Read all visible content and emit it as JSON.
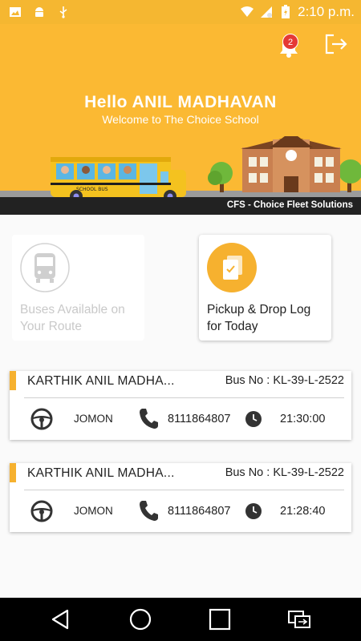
{
  "status_bar": {
    "time": "2:10 p.m."
  },
  "header": {
    "notification_count": "2",
    "greeting": "Hello ANIL MADHAVAN",
    "subtitle": "Welcome to The Choice School",
    "bus_sign": "SCHOOL BUS",
    "brand": "CFS - Choice Fleet Solutions"
  },
  "tiles": [
    {
      "label": "Buses Available on Your Route",
      "icon": "bus-icon",
      "enabled": false
    },
    {
      "label": "Pickup & Drop Log for Today",
      "icon": "log-icon",
      "enabled": true
    }
  ],
  "trips": [
    {
      "student": "KARTHIK ANIL MADHA...",
      "bus_no": "Bus No : KL-39-L-2522",
      "driver": "JOMON",
      "phone": "8111864807",
      "time": "21:30:00"
    },
    {
      "student": "KARTHIK ANIL MADHA...",
      "bus_no": "Bus No : KL-39-L-2522",
      "driver": "JOMON",
      "phone": "8111864807",
      "time": "21:28:40"
    }
  ],
  "colors": {
    "accent": "#fbb933",
    "status_bar": "#f5b731",
    "badge": "#e53935",
    "dark": "#222222"
  }
}
